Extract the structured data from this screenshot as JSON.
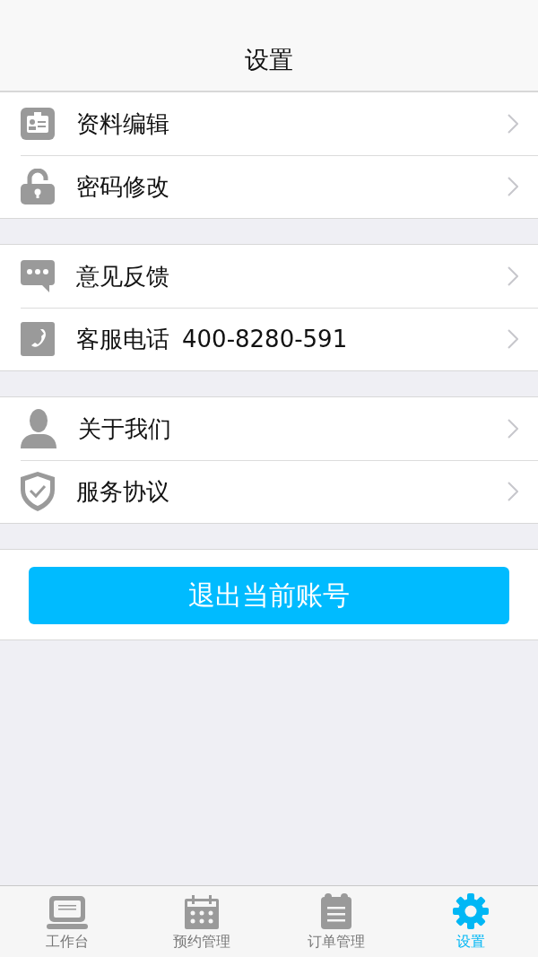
{
  "nav_bar": {
    "title": "设置"
  },
  "groups": [
    {
      "items": [
        {
          "label": "资料编辑"
        },
        {
          "label": "密码修改"
        }
      ]
    },
    {
      "items": [
        {
          "label": "意见反馈"
        },
        {
          "label": "客服电话",
          "detail": "400-8280-591"
        }
      ]
    },
    {
      "items": [
        {
          "label": "关于我们"
        },
        {
          "label": "服务协议"
        }
      ]
    }
  ],
  "logout_button": {
    "label": "退出当前账号"
  },
  "tab_bar": [
    {
      "label": "工作台",
      "selected": false
    },
    {
      "label": "预约管理",
      "selected": false
    },
    {
      "label": "订单管理",
      "selected": false
    },
    {
      "label": "设置",
      "selected": true
    }
  ]
}
